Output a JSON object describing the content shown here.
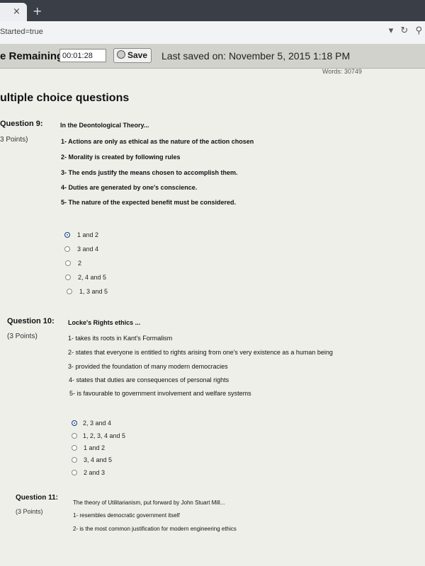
{
  "browser": {
    "tab_close": "×",
    "new_tab": "+",
    "url": "Started=true",
    "icons": [
      "dropdown-arrow",
      "reload-icon",
      "search-icon"
    ]
  },
  "status_bar": {
    "remaining_label": "e Remaining:",
    "timer": "00:01:28",
    "save_label": "Save",
    "last_saved": "Last saved on: November 5, 2015 1:18 PM",
    "words": "Words: 30749"
  },
  "section_title": "ultiple choice questions",
  "questions": [
    {
      "label": "Question 9:",
      "points": "3 Points)",
      "prompt": "In the Deontological Theory...",
      "statements": [
        "1- Actions are only as ethical as the nature of the action chosen",
        "2- Morality is created by following rules",
        "3- The ends justify the means chosen to accomplish them.",
        "4- Duties are generated by one's conscience.",
        "5- The nature of the expected benefit must be considered."
      ],
      "options": [
        "1 and 2",
        "3 and 4",
        "2",
        "2, 4 and 5",
        "1, 3 and 5"
      ],
      "selected": 0
    },
    {
      "label": "Question 10:",
      "points": "(3 Points)",
      "prompt": "Locke's Rights ethics ...",
      "statements": [
        "1- takes its roots in Kant's Formalism",
        "2- states that everyone is entitled to rights arising from one's very existence as a human being",
        "3- provided the foundation of many modern democracies",
        "4- states that duties are consequences of personal rights",
        "5- is favourable to government involvement and  welfare systems"
      ],
      "options": [
        "2, 3 and 4",
        "1, 2, 3, 4 and 5",
        "1 and 2",
        "3, 4 and 5",
        "2 and 3"
      ],
      "selected": 0
    },
    {
      "label": "Question 11:",
      "points": "(3 Points)",
      "prompt": "The theory of Utilitarianism, put forward by John Stuart Mill...",
      "statements": [
        "1- resembles democratic government itself",
        "2- is the most common justification for modern engineering ethics"
      ]
    }
  ]
}
